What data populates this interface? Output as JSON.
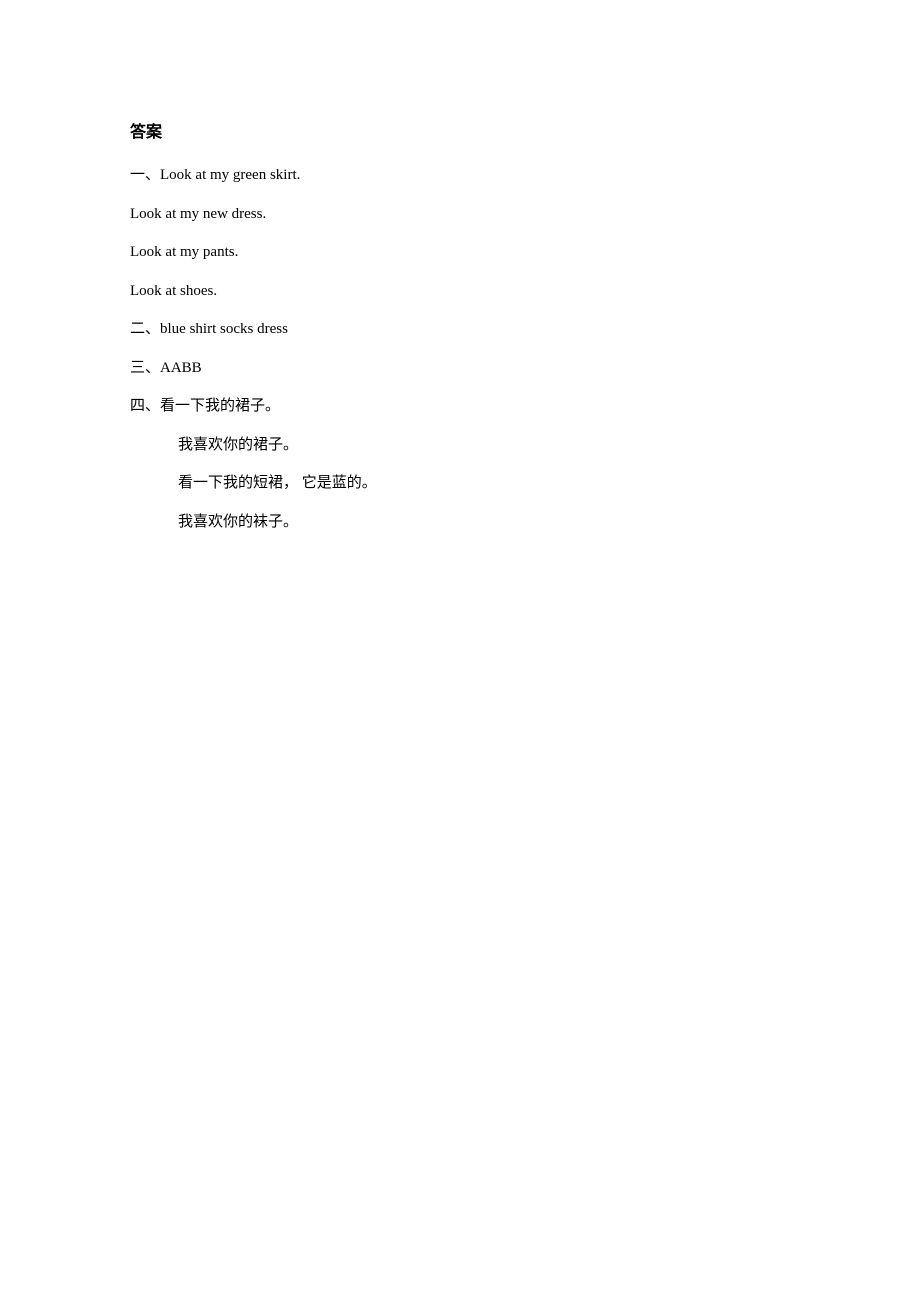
{
  "heading": "答案",
  "lines": [
    {
      "text": "一、Look at my green skirt.",
      "indent": false
    },
    {
      "text": "Look at my new dress.",
      "indent": false
    },
    {
      "text": "Look at my pants.",
      "indent": false
    },
    {
      "text": "Look at shoes.",
      "indent": false
    },
    {
      "text": "二、blue shirt socks dress",
      "indent": false
    },
    {
      "text": "三、AABB",
      "indent": false
    },
    {
      "text": "四、看一下我的裙子。",
      "indent": false
    },
    {
      "text": "我喜欢你的裙子。",
      "indent": true
    },
    {
      "text": "看一下我的短裙， 它是蓝的。",
      "indent": true
    },
    {
      "text": "我喜欢你的袜子。",
      "indent": true
    }
  ]
}
